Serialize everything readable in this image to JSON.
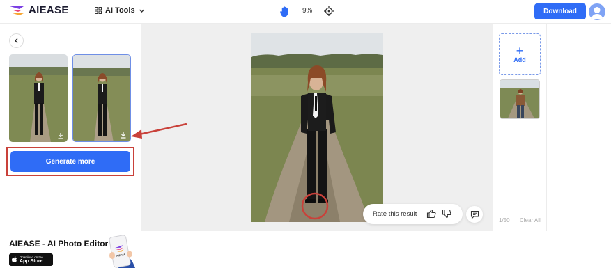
{
  "header": {
    "logo_text": "AIEASE",
    "ai_tools_label": "AI Tools",
    "zoom_level": "9%",
    "download_label": "Download"
  },
  "left_panel": {
    "generate_label": "Generate more",
    "selected_thumbnail_index": 1
  },
  "canvas": {
    "rate_label": "Rate this result"
  },
  "right_panel": {
    "add_label": "Add",
    "count_text": "1/50",
    "clear_all_label": "Clear All"
  },
  "footer": {
    "promo_title": "AIEASE - AI Photo Editor",
    "appstore_small": "Download on the",
    "appstore_big": "App Store",
    "phone_logo_text": "AIEASE"
  },
  "colors": {
    "accent": "#2f6cf6",
    "annotation_red": "#c9413a"
  },
  "icons": [
    "logo-icon",
    "grid-icon",
    "chevron-down-icon",
    "hand-icon",
    "crosshair-icon",
    "avatar-icon",
    "chevron-left-icon",
    "download-icon",
    "plus-icon",
    "thumbs-up-icon",
    "thumbs-down-icon",
    "comment-icon",
    "apple-icon"
  ]
}
